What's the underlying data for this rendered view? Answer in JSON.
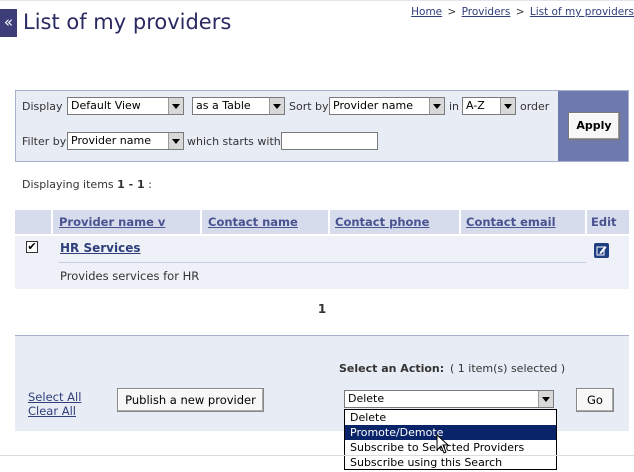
{
  "header": {
    "back_glyph": "«",
    "title": "List of my providers",
    "breadcrumb": [
      "Home",
      "Providers",
      "List of my providers"
    ],
    "breadcrumb_sep": ">"
  },
  "filter": {
    "display_label": "Display",
    "view_value": "Default View",
    "layout_value": "as a Table",
    "sort_label": "Sort by",
    "sort_value": "Provider name",
    "in_label": "in",
    "order_value": "A-Z",
    "order_label": "order",
    "filter_label": "Filter by",
    "filter_field_value": "Provider name",
    "starts_with_label": "which starts with",
    "starts_with_value": "",
    "apply_label": "Apply"
  },
  "listing": {
    "count_prefix": "Displaying items ",
    "count_range": "1 - 1",
    "count_suffix": " :",
    "columns": [
      "Provider name v",
      "Contact name",
      "Contact phone",
      "Contact email",
      "Edit"
    ],
    "rows": [
      {
        "checked": true,
        "check_glyph": "✔",
        "name": "HR Services",
        "description": "Provides services for HR"
      }
    ],
    "page": "1"
  },
  "actions": {
    "select_all": "Select All",
    "clear_all": "Clear All",
    "publish_label": "Publish a new provider",
    "select_action_label": "Select an Action:",
    "selected_count": "( 1 item(s) selected )",
    "action_value": "Delete",
    "options": [
      "Delete",
      "Promote/Demote",
      "Subscribe to Selected Providers",
      "Subscribe using this Search"
    ],
    "highlighted_option": "Promote/Demote",
    "go_label": "Go"
  },
  "colors": {
    "title": "#2a2a62",
    "panel_bg": "#e8ecf5",
    "apply_cell": "#6e79ad",
    "header_row": "#d7dcec",
    "highlight": "#0a246a"
  }
}
